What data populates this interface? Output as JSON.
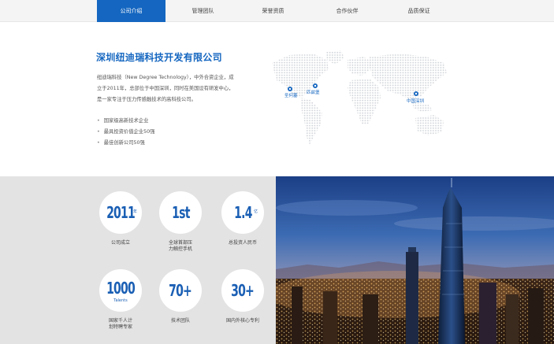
{
  "nav": {
    "tabs": [
      {
        "label": "公司介绍",
        "active": true
      },
      {
        "label": "管理团队",
        "active": false
      },
      {
        "label": "荣誉资质",
        "active": false
      },
      {
        "label": "合作伙伴",
        "active": false
      },
      {
        "label": "品质保证",
        "active": false
      }
    ]
  },
  "intro": {
    "title": "深圳纽迪瑞科技开发有限公司",
    "lines": [
      "纽迪瑞科技（New Degree Technology），中外合资企业，成",
      "立于2011年，总部位于中国深圳，同时在美国设有研发中心，",
      "是一家专注于压力传感触技术的高科技公司。"
    ],
    "bullets": [
      "国家级高新技术企业",
      "最具投资价值企业50强",
      "最佳创新公司50强"
    ]
  },
  "map": {
    "pins": [
      {
        "label": "圣何塞"
      },
      {
        "label": "匹兹堡"
      },
      {
        "label": "中国深圳"
      }
    ],
    "dot_color": "#cfd3d8",
    "pin_color": "#1466c0"
  },
  "stats": [
    {
      "value": "2011",
      "unit": "年",
      "sub": "",
      "caption": [
        "公司成立"
      ]
    },
    {
      "value": "1st",
      "unit": "",
      "sub": "",
      "caption": [
        "全球首部压",
        "力触控手机"
      ]
    },
    {
      "value": "1.4",
      "unit": "亿",
      "sub": "",
      "caption": [
        "总投资人民币"
      ]
    },
    {
      "value": "1000",
      "unit": "",
      "sub": "Talents",
      "caption": [
        "国家千人计",
        "划特聘专家"
      ]
    },
    {
      "value": "70+",
      "unit": "",
      "sub": "",
      "caption": [
        "技术团队"
      ]
    },
    {
      "value": "30+",
      "unit": "",
      "sub": "",
      "caption": [
        "国内外核心专利"
      ]
    }
  ],
  "colors": {
    "accent": "#1466c0",
    "stats_bg": "#e3e3e3",
    "nav_bg": "#f4f4f4"
  }
}
